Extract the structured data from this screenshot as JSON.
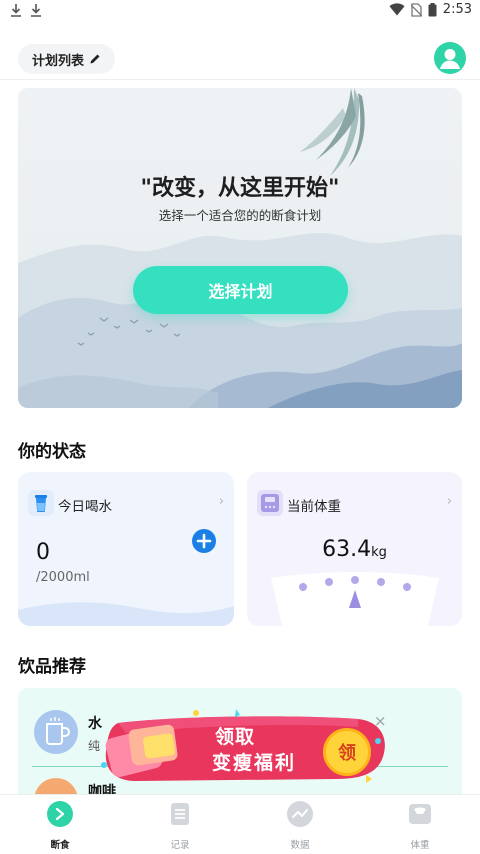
{
  "status_bar": {
    "time": "2:53",
    "left_icons": [
      "download-icon",
      "download-icon"
    ],
    "right_icons": [
      "wifi-icon",
      "no-sim-icon",
      "battery-icon"
    ]
  },
  "header": {
    "plan_list_label": "计划列表",
    "plan_list_icon": "pencil-icon",
    "avatar_icon": "user-avatar-icon"
  },
  "hero": {
    "title": "\"改变，从这里开始\"",
    "subtitle": "选择一个适合您的的断食计划",
    "button_label": "选择计划"
  },
  "status_section": {
    "title": "你的状态",
    "water_card": {
      "label": "今日喝水",
      "icon": "water-cup-icon",
      "value": "0",
      "goal": "/2000ml",
      "add_icon": "plus-circle-icon"
    },
    "weight_card": {
      "label": "当前体重",
      "icon": "scale-icon",
      "value": "63.4",
      "unit": "kg"
    }
  },
  "drinks_section": {
    "title": "饮品推荐",
    "items": [
      {
        "name": "水",
        "desc": "纯",
        "icon": "cup-icon"
      },
      {
        "name": "咖啡",
        "icon": "coffee-icon"
      }
    ]
  },
  "promo": {
    "line1": "领取",
    "line2": "变瘦福利",
    "coin_label": "领",
    "close_label": "×"
  },
  "bottom_nav": {
    "items": [
      {
        "label": "断食",
        "icon": "fasting-icon",
        "active": true
      },
      {
        "label": "记录",
        "icon": "record-icon",
        "active": false
      },
      {
        "label": "数据",
        "icon": "data-icon",
        "active": false
      },
      {
        "label": "体重",
        "icon": "weight-icon",
        "active": false
      }
    ]
  },
  "colors": {
    "accent": "#34e0bf",
    "water_blue": "#1b7fe6",
    "promo_pink": "#e8365d"
  }
}
